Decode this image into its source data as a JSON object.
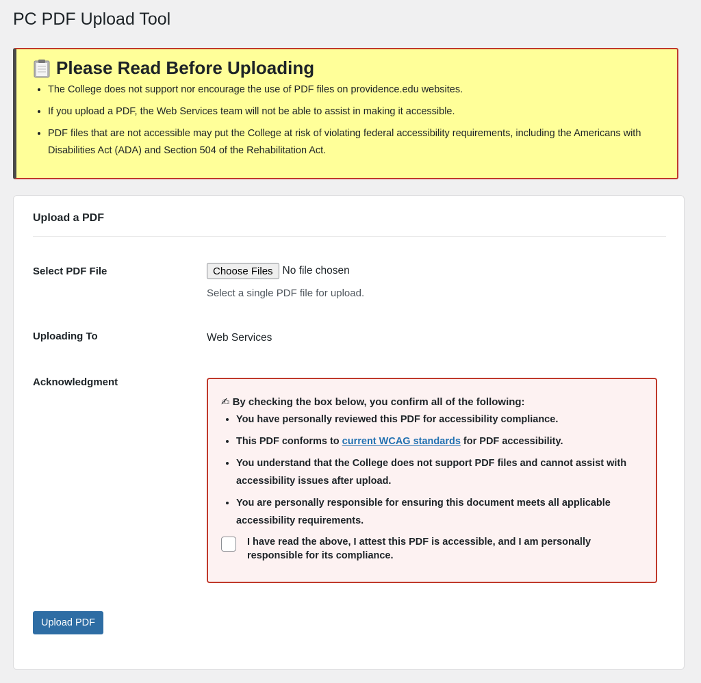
{
  "page": {
    "title": "PC PDF Upload Tool"
  },
  "notice": {
    "heading": "Please Read Before Uploading",
    "items": [
      "The College does not support nor encourage the use of PDF files on providence.edu websites.",
      "If you upload a PDF, the Web Services team will not be able to assist in making it accessible.",
      "PDF files that are not accessible may put the College at risk of violating federal accessibility requirements, including the Americans with Disabilities Act (ADA) and Section 504 of the Rehabilitation Act."
    ],
    "colors": {
      "background": "#ffff99",
      "border": "#c0392b"
    }
  },
  "form": {
    "title": "Upload a PDF",
    "file": {
      "label": "Select PDF File",
      "button_label": "Choose Files",
      "status": "No file chosen",
      "help": "Select a single PDF file for upload."
    },
    "uploading_to": {
      "label": "Uploading To",
      "value": "Web Services"
    },
    "acknowledgment": {
      "label": "Acknowledgment",
      "heading_icon": "✍",
      "heading": "By checking the box below, you confirm all of the following:",
      "items": [
        "You have personally reviewed this PDF for accessibility compliance.",
        "You understand that the College does not support PDF files and cannot assist with accessibility issues after upload.",
        "You are personally responsible for ensuring this document meets all applicable accessibility requirements."
      ],
      "wcag_item": {
        "before": "This PDF conforms to ",
        "link": "current WCAG standards",
        "after": " for PDF accessibility."
      },
      "checkbox_label": "I have read the above, I attest this PDF is accessible, and I am personally responsible for its compliance.",
      "checkbox_checked": false
    },
    "submit_label": "Upload PDF"
  }
}
